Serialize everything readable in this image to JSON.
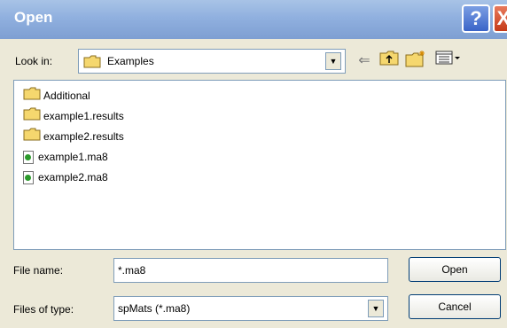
{
  "dialog": {
    "title": "Open",
    "help_label": "?",
    "close_label": "X"
  },
  "lookin": {
    "label": "Look in:",
    "value": "Examples"
  },
  "files": [
    {
      "name": "Additional",
      "icon": "folder-icon"
    },
    {
      "name": "example1.results",
      "icon": "folder-icon"
    },
    {
      "name": "example2.results",
      "icon": "folder-icon"
    },
    {
      "name": "example1.ma8",
      "icon": "ma8-file-icon"
    },
    {
      "name": "example2.ma8",
      "icon": "ma8-file-icon"
    }
  ],
  "filename": {
    "label": "File name:",
    "value": "*.ma8"
  },
  "filetype": {
    "label": "Files of type:",
    "value": "spMats (*.ma8)"
  },
  "buttons": {
    "open": "Open",
    "cancel": "Cancel"
  },
  "colors": {
    "titlebar": "#90b0df",
    "dialog_bg": "#ece9d8",
    "border": "#7f9db9",
    "folder": "#f5d76e"
  }
}
